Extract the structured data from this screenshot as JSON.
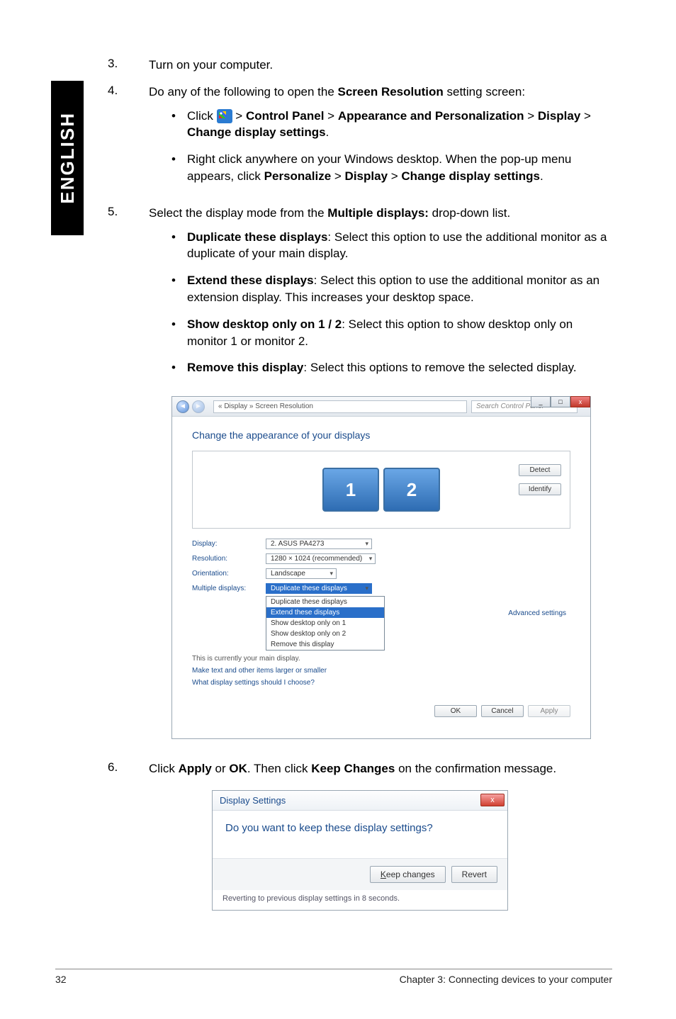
{
  "sidebar": {
    "lang": "ENGLISH"
  },
  "steps": {
    "s3": {
      "num": "3.",
      "text": "Turn on your computer."
    },
    "s4": {
      "num": "4.",
      "intro_a": "Do any of the following to open the ",
      "intro_b": "Screen Resolution",
      "intro_c": " setting screen:",
      "b1_a": "Click ",
      "b1_b": " > ",
      "b1_cp": "Control Panel",
      "b1_ap": "Appearance and Personalization",
      "b1_dp": "Display",
      "b1_cs": "Change display settings",
      "b1_dot": ".",
      "b2_a": "Right click anywhere on your Windows desktop. When the pop-up menu appears, click ",
      "b2_p1": "Personalize",
      "b2_p2": "Display",
      "b2_p3": "Change display settings",
      "b2_dot": "."
    },
    "s5": {
      "num": "5.",
      "intro_a": "Select the display mode from the ",
      "intro_b": "Multiple displays:",
      "intro_c": " drop-down list.",
      "b1_t": "Duplicate these displays",
      "b1_x": ": Select this option to use the additional monitor as a duplicate of your main display.",
      "b2_t": "Extend these displays",
      "b2_x": ": Select this option to use the additional monitor as an extension display. This increases your desktop space.",
      "b3_t": "Show desktop only on 1 / 2",
      "b3_x": ": Select this option to show desktop only on monitor 1 or monitor 2.",
      "b4_t": "Remove this display",
      "b4_x": ": Select this options to remove the selected display."
    },
    "s6": {
      "num": "6.",
      "a": "Click ",
      "b": "Apply",
      "c": " or ",
      "d": "OK",
      "e": ". Then click ",
      "f": "Keep Changes",
      "g": " on the confirmation message."
    }
  },
  "fig1": {
    "addr_arrow": "◄",
    "addr": "« Display » Screen Resolution",
    "search": "Search Control Panel",
    "title_min": "_",
    "title_max": "□",
    "title_close": "x",
    "heading": "Change the appearance of your displays",
    "mon1": "1",
    "mon2": "2",
    "detect": "Detect",
    "identify": "Identify",
    "row_display_lbl": "Display:",
    "row_display_val": "2. ASUS PA4273",
    "row_res_lbl": "Resolution:",
    "row_res_val": "1280 × 1024 (recommended)",
    "row_orient_lbl": "Orientation:",
    "row_orient_val": "Landscape",
    "row_multi_lbl": "Multiple displays:",
    "row_multi_val": "Duplicate these displays",
    "dd1": "Duplicate these displays",
    "dd2": "Extend these displays",
    "dd3": "Show desktop only on 1",
    "dd4": "Show desktop only on 2",
    "dd5": "Remove this display",
    "note": "This is currently your main display.",
    "link1": "Make text and other items larger or smaller",
    "link2": "What display settings should I choose?",
    "adv": "Advanced settings",
    "ok": "OK",
    "cancel": "Cancel",
    "apply": "Apply"
  },
  "fig2": {
    "title": "Display Settings",
    "close": "x",
    "question": "Do you want to keep these display settings?",
    "keep": "Keep changes",
    "revert": "Revert",
    "footer": "Reverting to previous display settings in 8 seconds."
  },
  "footer": {
    "page": "32",
    "chapter": "Chapter 3: Connecting devices to your computer"
  },
  "chart_data": {
    "type": "table",
    "title": "Change the appearance of your displays",
    "rows": [
      {
        "label": "Display:",
        "value": "2. ASUS PA4273"
      },
      {
        "label": "Resolution:",
        "value": "1280 × 1024 (recommended)"
      },
      {
        "label": "Orientation:",
        "value": "Landscape"
      },
      {
        "label": "Multiple displays:",
        "value": "Duplicate these displays"
      }
    ],
    "dropdown_options": [
      "Duplicate these displays",
      "Extend these displays",
      "Show desktop only on 1",
      "Show desktop only on 2",
      "Remove this display"
    ],
    "buttons_right": [
      "Detect",
      "Identify"
    ],
    "buttons_bottom": [
      "OK",
      "Cancel",
      "Apply"
    ],
    "links": [
      "Advanced settings",
      "Make text and other items larger or smaller",
      "What display settings should I choose?"
    ],
    "dialog": {
      "title": "Display Settings",
      "question": "Do you want to keep these display settings?",
      "buttons": [
        "Keep changes",
        "Revert"
      ],
      "footer": "Reverting to previous display settings in 8 seconds."
    }
  }
}
